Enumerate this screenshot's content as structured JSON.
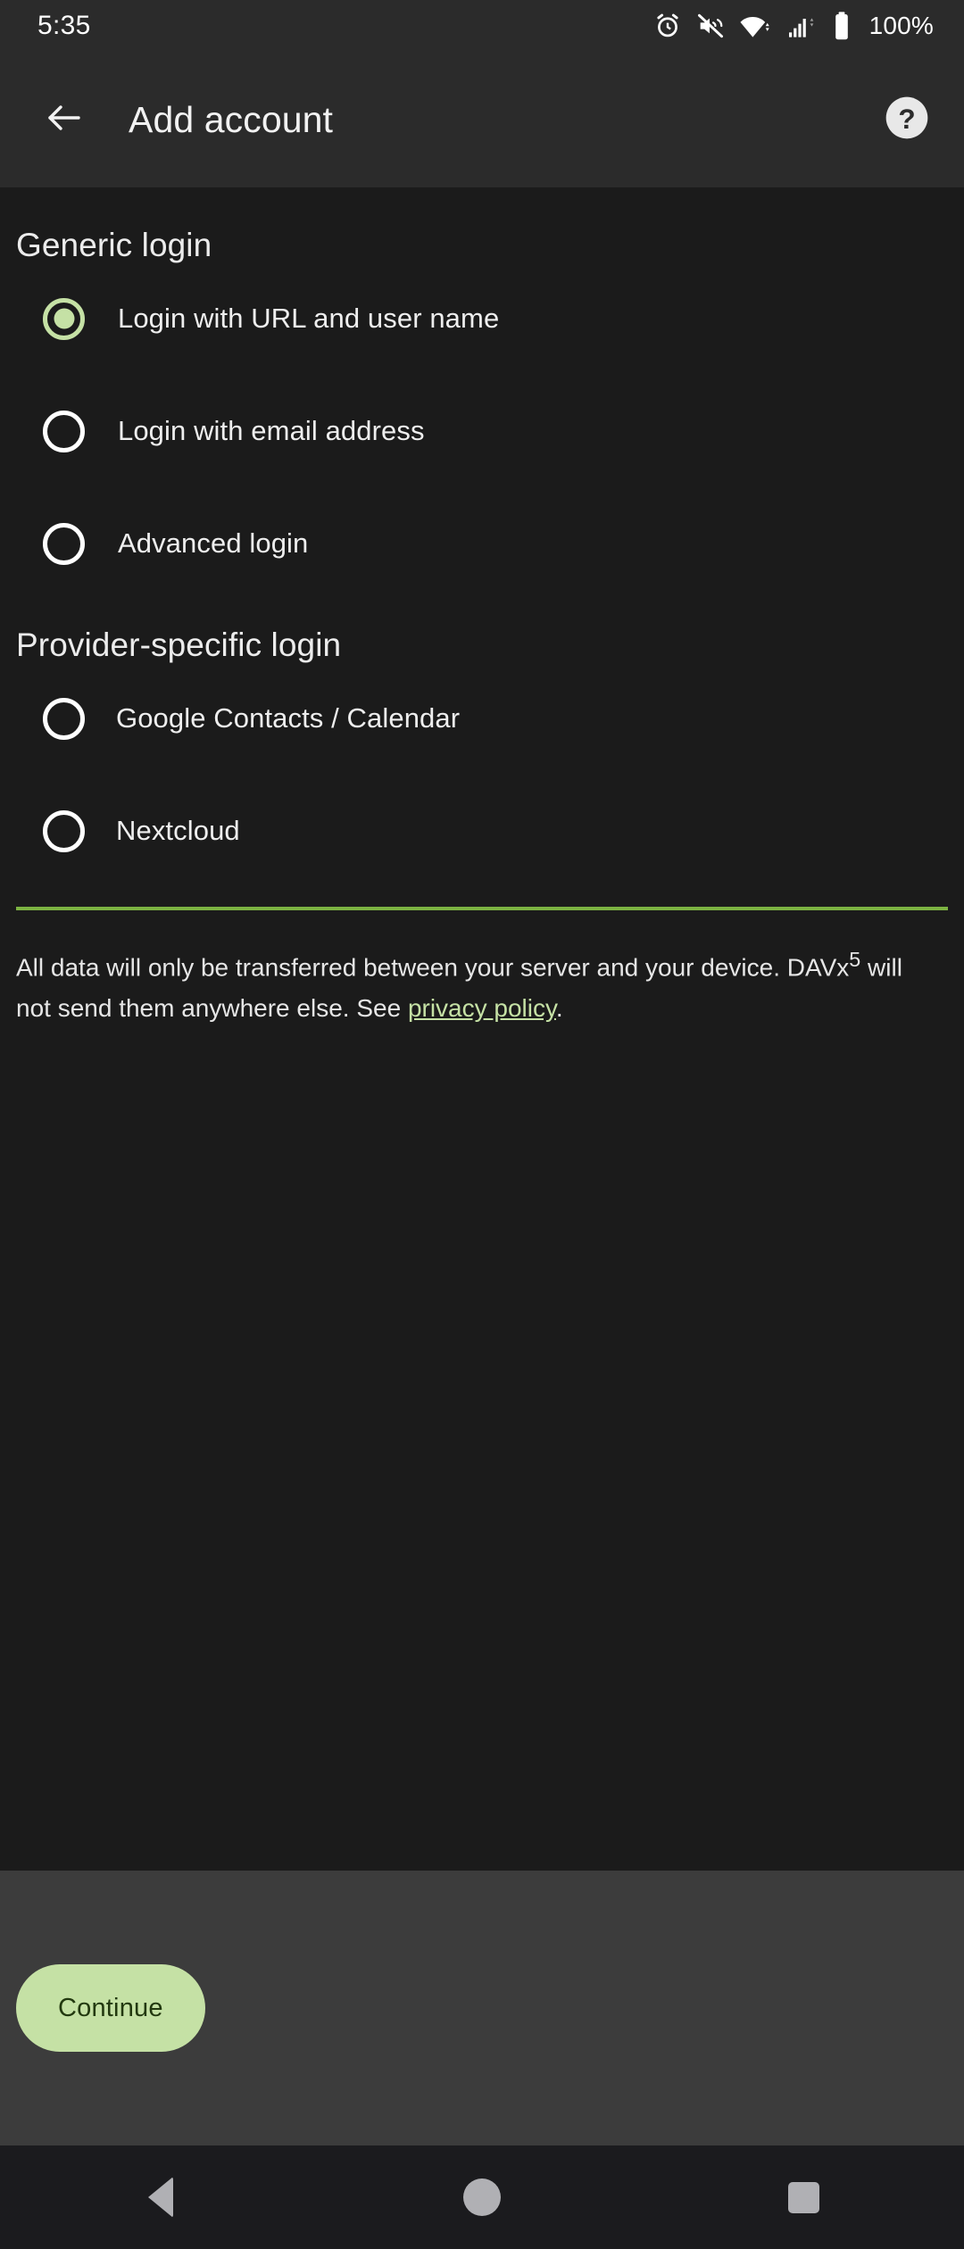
{
  "statusbar": {
    "time": "5:35",
    "battery_text": "100%",
    "icons": [
      "alarm-icon",
      "volume-mute-icon",
      "wifi-icon",
      "cellular-signal-icon",
      "battery-icon"
    ]
  },
  "appbar": {
    "back_icon": "arrow-back-icon",
    "title": "Add account",
    "help_icon": "help-circle-icon"
  },
  "sections": [
    {
      "title": "Generic login",
      "options": [
        {
          "label": "Login with URL and user name",
          "selected": true
        },
        {
          "label": "Login with email address",
          "selected": false
        },
        {
          "label": "Advanced login",
          "selected": false
        }
      ]
    },
    {
      "title": "Provider-specific login",
      "options": [
        {
          "label": "Google Contacts / Calendar",
          "selected": false
        },
        {
          "label": "Nextcloud",
          "selected": false
        }
      ]
    }
  ],
  "privacy": {
    "text_before": "All data will only be transferred between your server and your device. DAVx",
    "superscript": "5",
    "text_middle": " will not send them anywhere else. See ",
    "link_label": "privacy policy",
    "text_after": "."
  },
  "bottombar": {
    "continue_label": "Continue"
  },
  "navbar": {
    "back_label": "back-nav",
    "home_label": "home-nav",
    "recents_label": "recents-nav"
  },
  "colors": {
    "accent_green": "#c5e1a5",
    "divider_green": "#7cb342",
    "appbar_bg": "#2b2b2b",
    "content_bg": "#1b1b1b",
    "bottombar_bg": "#3c3c3c",
    "navbar_bg": "#1b1b1e"
  }
}
